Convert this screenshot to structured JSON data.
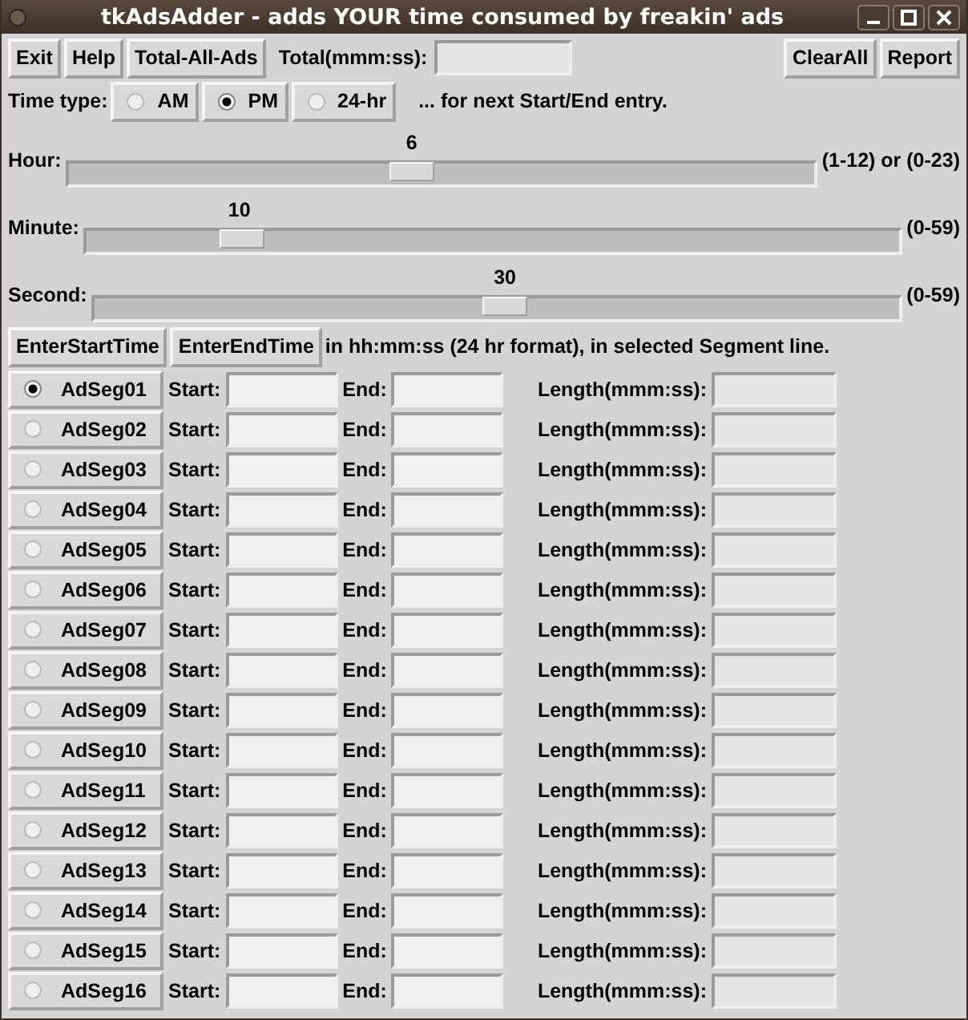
{
  "window": {
    "title": "tkAdsAdder - adds YOUR time consumed by freakin' ads"
  },
  "toolbar": {
    "buttons_left": [
      "Exit",
      "Help",
      "Total-All-Ads"
    ],
    "total_label": "Total(mmm:ss):",
    "buttons_right": [
      "ClearAll",
      "Report"
    ]
  },
  "time_type": {
    "label": "Time type:",
    "options": [
      {
        "label": "AM",
        "selected": false
      },
      {
        "label": "PM",
        "selected": true
      },
      {
        "label": "24-hr",
        "selected": false
      }
    ],
    "note": "... for next Start/End entry."
  },
  "sliders": [
    {
      "label": "Hour:",
      "value": "6",
      "level": 0.46,
      "range": "(1-12) or (0-23)"
    },
    {
      "label": "Minute:",
      "value": "10",
      "level": 0.19,
      "range": "(0-59)"
    },
    {
      "label": "Second:",
      "value": "30",
      "level": 0.51,
      "range": "(0-59)"
    }
  ],
  "entry_buttons": [
    "EnterStartTime",
    "EnterEndTime"
  ],
  "entry_note": "in hh:mm:ss (24 hr format), in selected Segment line.",
  "segments": [
    {
      "name": "AdSeg01",
      "selected": true,
      "start_label": "Start:",
      "end_label": "End:",
      "length_label": "Length(mmm:ss):"
    },
    {
      "name": "AdSeg02",
      "selected": false,
      "start_label": "Start:",
      "end_label": "End:",
      "length_label": "Length(mmm:ss):"
    },
    {
      "name": "AdSeg03",
      "selected": false,
      "start_label": "Start:",
      "end_label": "End:",
      "length_label": "Length(mmm:ss):"
    },
    {
      "name": "AdSeg04",
      "selected": false,
      "start_label": "Start:",
      "end_label": "End:",
      "length_label": "Length(mmm:ss):"
    },
    {
      "name": "AdSeg05",
      "selected": false,
      "start_label": "Start:",
      "end_label": "End:",
      "length_label": "Length(mmm:ss):"
    },
    {
      "name": "AdSeg06",
      "selected": false,
      "start_label": "Start:",
      "end_label": "End:",
      "length_label": "Length(mmm:ss):"
    },
    {
      "name": "AdSeg07",
      "selected": false,
      "start_label": "Start:",
      "end_label": "End:",
      "length_label": "Length(mmm:ss):"
    },
    {
      "name": "AdSeg08",
      "selected": false,
      "start_label": "Start:",
      "end_label": "End:",
      "length_label": "Length(mmm:ss):"
    },
    {
      "name": "AdSeg09",
      "selected": false,
      "start_label": "Start:",
      "end_label": "End:",
      "length_label": "Length(mmm:ss):"
    },
    {
      "name": "AdSeg10",
      "selected": false,
      "start_label": "Start:",
      "end_label": "End:",
      "length_label": "Length(mmm:ss):"
    },
    {
      "name": "AdSeg11",
      "selected": false,
      "start_label": "Start:",
      "end_label": "End:",
      "length_label": "Length(mmm:ss):"
    },
    {
      "name": "AdSeg12",
      "selected": false,
      "start_label": "Start:",
      "end_label": "End:",
      "length_label": "Length(mmm:ss):"
    },
    {
      "name": "AdSeg13",
      "selected": false,
      "start_label": "Start:",
      "end_label": "End:",
      "length_label": "Length(mmm:ss):"
    },
    {
      "name": "AdSeg14",
      "selected": false,
      "start_label": "Start:",
      "end_label": "End:",
      "length_label": "Length(mmm:ss):"
    },
    {
      "name": "AdSeg15",
      "selected": false,
      "start_label": "Start:",
      "end_label": "End:",
      "length_label": "Length(mmm:ss):"
    },
    {
      "name": "AdSeg16",
      "selected": false,
      "start_label": "Start:",
      "end_label": "End:",
      "length_label": "Length(mmm:ss):"
    }
  ]
}
